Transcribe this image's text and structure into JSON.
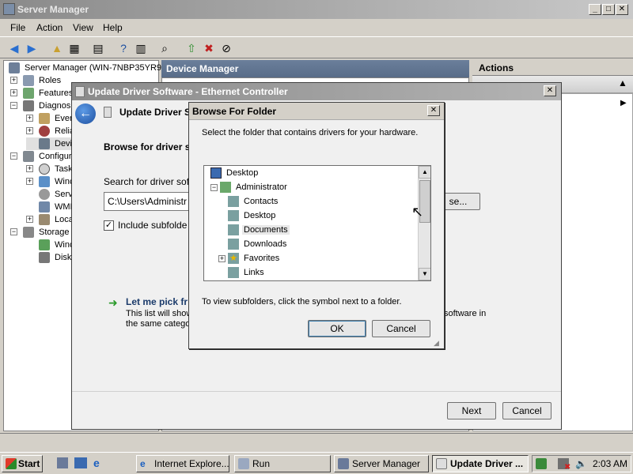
{
  "server_manager": {
    "title": "Server Manager",
    "menu": [
      "File",
      "Action",
      "View",
      "Help"
    ],
    "tree": {
      "root": "Server Manager (WIN-7NBP35YR9",
      "items": [
        "Roles",
        "Features",
        "Diagnos",
        "Even",
        "Relia",
        "Devi",
        "Configur",
        "Task",
        "Winc",
        "Serv",
        "WMI",
        "Loca",
        "Storage",
        "Winc",
        "Disk"
      ]
    },
    "center_header": "Device Manager",
    "actions_header": "Actions"
  },
  "update_driver": {
    "title": "Update Driver Software - Ethernet Controller",
    "heading": "Update Driver S",
    "browse_label": "Browse for driver s",
    "search_label": "Search for driver soft",
    "path_value": "C:\\Users\\Administr",
    "browse_button": "se...",
    "include_subfolders": "Include subfolde",
    "let_me_pick": "Let me pick fr",
    "desc_line1": "This list will show",
    "desc_line2": "the same catego",
    "desc_right1": "software in",
    "next_button": "Next",
    "cancel_button": "Cancel"
  },
  "browse_folder": {
    "title": "Browse For Folder",
    "instruction": "Select the folder that contains drivers for your hardware.",
    "folders": [
      {
        "label": "Desktop",
        "level": 0,
        "expander": "",
        "selected": false
      },
      {
        "label": "Administrator",
        "level": 1,
        "expander": "−",
        "selected": false
      },
      {
        "label": "Contacts",
        "level": 2,
        "expander": "",
        "selected": false
      },
      {
        "label": "Desktop",
        "level": 2,
        "expander": "",
        "selected": false
      },
      {
        "label": "Documents",
        "level": 2,
        "expander": "",
        "selected": true
      },
      {
        "label": "Downloads",
        "level": 2,
        "expander": "",
        "selected": false
      },
      {
        "label": "Favorites",
        "level": 2,
        "expander": "+",
        "selected": false
      },
      {
        "label": "Links",
        "level": 2,
        "expander": "",
        "selected": false
      }
    ],
    "hint": "To view subfolders, click the symbol next to a folder.",
    "ok": "OK",
    "cancel": "Cancel"
  },
  "taskbar": {
    "start": "Start",
    "tasks": [
      "Internet Explore...",
      "Run",
      "Server Manager",
      "Update Driver ..."
    ],
    "clock": "2:03 AM"
  },
  "colors": {
    "inactive_title": "#8a8a8a",
    "selected_bg": "#e8e8e8",
    "dialog_bg": "#f0f0f0",
    "accent_blue": "#1d4fa0"
  }
}
